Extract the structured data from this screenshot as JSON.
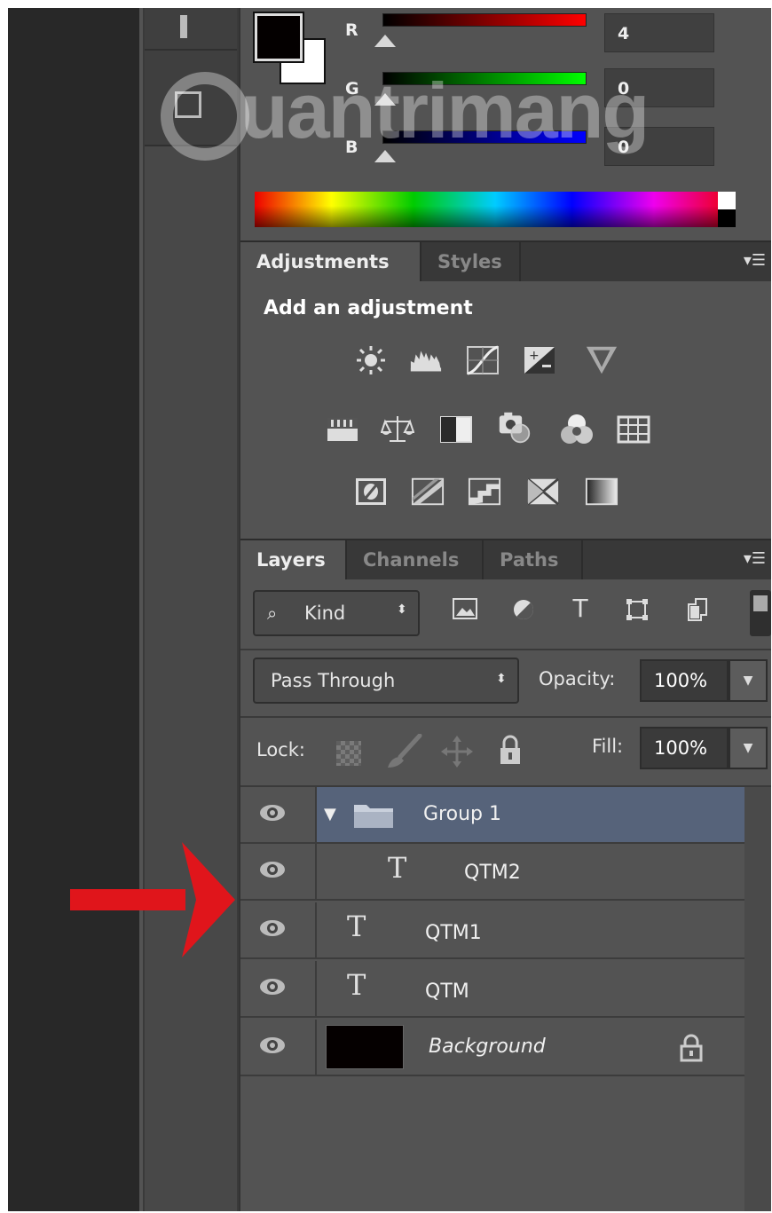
{
  "color_panel": {
    "r_label": "R",
    "g_label": "G",
    "b_label": "B",
    "r_value": "4",
    "g_value": "0",
    "b_value": "0",
    "foreground": "#040000",
    "background": "#ffffff"
  },
  "adjustments": {
    "tabs": [
      "Adjustments",
      "Styles"
    ],
    "title": "Add an adjustment",
    "icons_row1": [
      "brightness-contrast-icon",
      "levels-icon",
      "curves-icon",
      "exposure-icon",
      "vibrance-icon"
    ],
    "icons_row2": [
      "hue-saturation-icon",
      "color-balance-icon",
      "black-white-icon",
      "photo-filter-icon",
      "channel-mixer-icon",
      "color-lookup-icon"
    ],
    "icons_row3": [
      "invert-icon",
      "posterize-icon",
      "threshold-icon",
      "selective-color-icon",
      "gradient-map-icon"
    ]
  },
  "layers": {
    "tabs": [
      "Layers",
      "Channels",
      "Paths"
    ],
    "filter_kind": "Kind",
    "blend_mode": "Pass Through",
    "opacity_label": "Opacity:",
    "opacity_value": "100%",
    "lock_label": "Lock:",
    "fill_label": "Fill:",
    "fill_value": "100%",
    "rows": [
      {
        "name": "Group 1",
        "type": "group",
        "selected": true
      },
      {
        "name": "QTM2",
        "type": "text",
        "indent": true
      },
      {
        "name": "QTM1",
        "type": "text"
      },
      {
        "name": "QTM",
        "type": "text"
      },
      {
        "name": "Background",
        "type": "pixel",
        "locked": true
      }
    ]
  },
  "watermark": {
    "text": "uantrimang"
  },
  "annotation": {
    "arrow_color": "#e0151b"
  }
}
